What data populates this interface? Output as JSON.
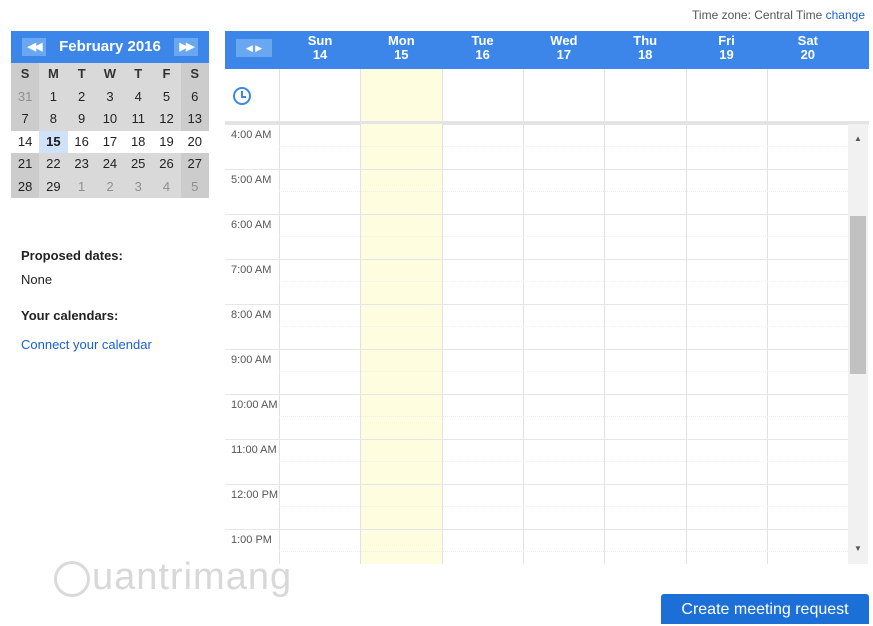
{
  "timezone": {
    "label": "Time zone: Central Time",
    "change_link": "change"
  },
  "mini_calendar": {
    "title": "February 2016",
    "prev_icon": "double-left-arrow",
    "next_icon": "double-right-arrow",
    "days_of_week": [
      "S",
      "M",
      "T",
      "W",
      "T",
      "F",
      "S"
    ],
    "weeks": [
      [
        "31",
        "1",
        "2",
        "3",
        "4",
        "5",
        "6"
      ],
      [
        "7",
        "8",
        "9",
        "10",
        "11",
        "12",
        "13"
      ],
      [
        "14",
        "15",
        "16",
        "17",
        "18",
        "19",
        "20"
      ],
      [
        "21",
        "22",
        "23",
        "24",
        "25",
        "26",
        "27"
      ],
      [
        "28",
        "29",
        "1",
        "2",
        "3",
        "4",
        "5"
      ]
    ],
    "selected_week_index": 2,
    "today": "15"
  },
  "sidebar": {
    "proposed_label": "Proposed dates:",
    "proposed_value": "None",
    "calendars_label": "Your calendars:",
    "connect_link": "Connect your calendar"
  },
  "week": {
    "nav_icon": "left-right-arrows",
    "days": [
      {
        "name": "Sun",
        "date": "14"
      },
      {
        "name": "Mon",
        "date": "15"
      },
      {
        "name": "Tue",
        "date": "16"
      },
      {
        "name": "Wed",
        "date": "17"
      },
      {
        "name": "Thu",
        "date": "18"
      },
      {
        "name": "Fri",
        "date": "19"
      },
      {
        "name": "Sat",
        "date": "20"
      }
    ],
    "highlight_day": "Mon",
    "times": [
      "4:00 AM",
      "5:00 AM",
      "6:00 AM",
      "7:00 AM",
      "8:00 AM",
      "9:00 AM",
      "10:00 AM",
      "11:00 AM",
      "12:00 PM",
      "1:00 PM"
    ]
  },
  "colors": {
    "accent": "#3b86e8",
    "today_column": "#fffde0",
    "button": "#1d6fd8",
    "link": "#1a5fd0"
  },
  "watermark": "uantrimang",
  "create_button": "Create meeting request"
}
